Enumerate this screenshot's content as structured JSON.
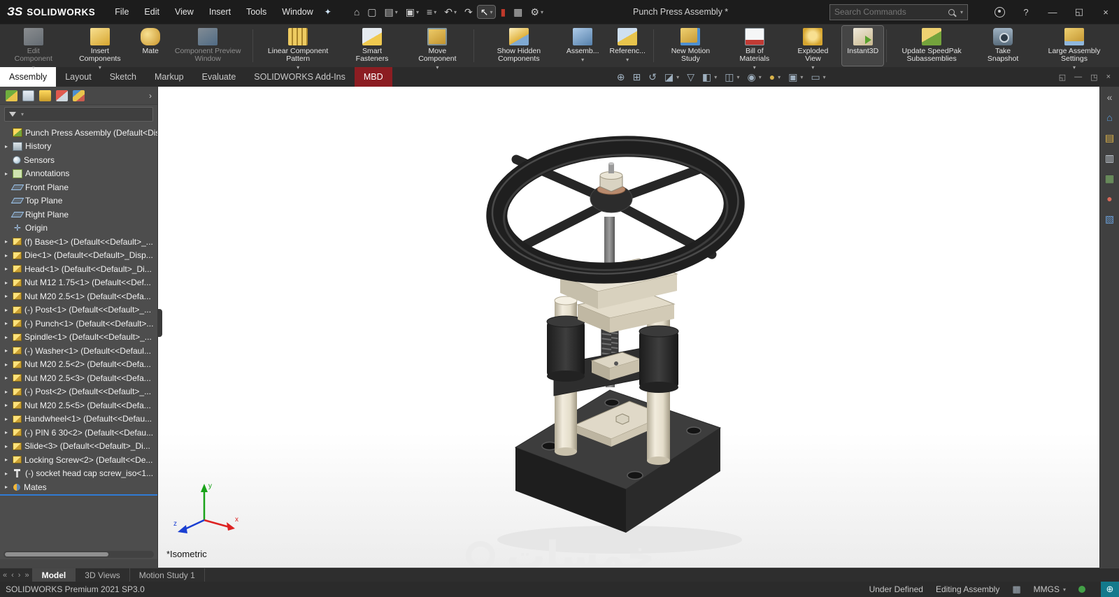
{
  "colors": {
    "selection_accent": "#2f7bd4",
    "mbd_red": "#8c1d22",
    "status_tile_teal": "#137a8c",
    "tab_active_bg": "#ffffff"
  },
  "titlebar": {
    "logo": "ЗS",
    "brand": "SOLIDWORKS",
    "menus": [
      "File",
      "Edit",
      "View",
      "Insert",
      "Tools",
      "Window"
    ],
    "pin_glyph": "✦",
    "tools": [
      {
        "name": "home-icon",
        "glyph": "⌂"
      },
      {
        "name": "new-document-icon",
        "glyph": "▢"
      },
      {
        "name": "open-document-icon",
        "glyph": "▤",
        "caret": true
      },
      {
        "name": "save-icon",
        "glyph": "▣",
        "caret": true
      },
      {
        "name": "print-icon",
        "glyph": "≡",
        "caret": true
      },
      {
        "name": "undo-icon",
        "glyph": "↶",
        "caret": true
      },
      {
        "name": "redo-icon",
        "glyph": "↷"
      },
      {
        "name": "select-arrow-icon",
        "glyph": "↖",
        "active": true,
        "caret": true
      },
      {
        "name": "record-icon",
        "glyph": "▮",
        "red": true
      },
      {
        "name": "spreadsheet-icon",
        "glyph": "▦"
      },
      {
        "name": "options-gear-icon",
        "glyph": "⚙",
        "caret": true
      }
    ],
    "document_title": "Punch Press Assembly *",
    "search_placeholder": "Search Commands",
    "search_caret": "▾",
    "right_icons": [
      {
        "name": "account-icon",
        "glyph": ""
      },
      {
        "name": "help-icon",
        "glyph": "?"
      },
      {
        "name": "minimize-icon",
        "glyph": "—"
      },
      {
        "name": "restore-icon",
        "glyph": "◱"
      },
      {
        "name": "close-icon",
        "glyph": "×"
      }
    ]
  },
  "ribbon": {
    "buttons": [
      {
        "label": "Edit Component",
        "icon": "edit-component-icon",
        "icon_class": "ri-editc",
        "dropdown": true,
        "disabled": true
      },
      {
        "label": "Insert Components",
        "icon": "insert-components-icon",
        "icon_class": "ri-insertc",
        "dropdown": true
      },
      {
        "label": "Mate",
        "icon": "mate-icon",
        "icon_class": "ri-mate"
      },
      {
        "label": "Component Preview Window",
        "icon": "component-preview-icon",
        "icon_class": "ri-prevw",
        "disabled": true
      },
      {
        "label": "Linear Component Pattern",
        "icon": "linear-pattern-icon",
        "icon_class": "ri-linpat",
        "dropdown": true,
        "sep": true
      },
      {
        "label": "Smart Fasteners",
        "icon": "smart-fasteners-icon",
        "icon_class": "ri-smartf"
      },
      {
        "label": "Move Component",
        "icon": "move-component-icon",
        "icon_class": "ri-movec",
        "dropdown": true
      },
      {
        "label": "Show Hidden Components",
        "icon": "show-hidden-icon",
        "icon_class": "ri-showh",
        "sep": true
      },
      {
        "label": "Assemb...",
        "icon": "assembly-features-icon",
        "icon_class": "ri-asmfeat",
        "dropdown": true
      },
      {
        "label": "Referenc...",
        "icon": "reference-geometry-icon",
        "icon_class": "ri-refgeo",
        "dropdown": true
      },
      {
        "label": "New Motion Study",
        "icon": "new-motion-study-icon",
        "icon_class": "ri-motion",
        "sep": true
      },
      {
        "label": "Bill of Materials",
        "icon": "bill-of-materials-icon",
        "icon_class": "ri-bom",
        "dropdown": true
      },
      {
        "label": "Exploded View",
        "icon": "exploded-view-icon",
        "icon_class": "ri-explode",
        "dropdown": true
      },
      {
        "label": "Instant3D",
        "icon": "instant3d-icon",
        "icon_class": "ri-instant3d",
        "active": true
      },
      {
        "label": "Update SpeedPak Subassemblies",
        "icon": "update-speedpak-icon",
        "icon_class": "ri-speedpak",
        "sep": true
      },
      {
        "label": "Take Snapshot",
        "icon": "take-snapshot-icon",
        "icon_class": "ri-snapshot"
      },
      {
        "label": "Large Assembly Settings",
        "icon": "large-assembly-icon",
        "icon_class": "ri-lrgasm",
        "dropdown": true
      }
    ]
  },
  "tabs": [
    {
      "label": "Assembly",
      "active": true
    },
    {
      "label": "Layout"
    },
    {
      "label": "Sketch"
    },
    {
      "label": "Markup"
    },
    {
      "label": "Evaluate"
    },
    {
      "label": "SOLIDWORKS Add-Ins"
    },
    {
      "label": "MBD",
      "style": "mbd"
    }
  ],
  "headsup": [
    {
      "name": "zoom-fit-icon",
      "glyph": "⊕"
    },
    {
      "name": "zoom-area-icon",
      "glyph": "⊞"
    },
    {
      "name": "previous-view-icon",
      "glyph": "↺"
    },
    {
      "name": "section-view-icon",
      "glyph": "◪",
      "caret": true
    },
    {
      "name": "dynamic-annotation-icon",
      "glyph": "▽"
    },
    {
      "name": "view-orientation-icon",
      "glyph": "◧",
      "caret": true
    },
    {
      "name": "display-style-icon",
      "glyph": "◫",
      "caret": true
    },
    {
      "name": "hide-show-icon",
      "glyph": "◉",
      "caret": true
    },
    {
      "name": "edit-appearance-icon",
      "glyph": "●",
      "gold": true,
      "caret": true
    },
    {
      "name": "apply-scene-icon",
      "glyph": "▣",
      "caret": true
    },
    {
      "name": "view-settings-icon",
      "glyph": "▭",
      "caret": true
    }
  ],
  "doc_controls": [
    {
      "name": "doc-undock-icon",
      "glyph": "◱"
    },
    {
      "name": "doc-minimize-icon",
      "glyph": "—"
    },
    {
      "name": "doc-restore-icon",
      "glyph": "◳"
    },
    {
      "name": "doc-close-icon",
      "glyph": "×"
    }
  ],
  "panel": {
    "tabs": [
      {
        "name": "featuremanager-tab-icon",
        "cls": "pt-fm"
      },
      {
        "name": "propertymanager-tab-icon",
        "cls": "pt-pm"
      },
      {
        "name": "configurationmanager-tab-icon",
        "cls": "pt-cm"
      },
      {
        "name": "dimxpertmanager-tab-icon",
        "cls": "pt-dx"
      },
      {
        "name": "displaymanager-tab-icon",
        "cls": "pt-dm"
      }
    ],
    "expand_chevron": "›",
    "tree": [
      {
        "label": "Punch Press Assembly  (Default<Disp...",
        "icon": "assembly-icon",
        "icon_class": "i-asm"
      },
      {
        "label": "History",
        "icon": "history-folder-icon",
        "icon_class": "i-hist",
        "caret": true
      },
      {
        "label": "Sensors",
        "icon": "sensors-icon",
        "icon_class": "i-sens"
      },
      {
        "label": "Annotations",
        "icon": "annotations-icon",
        "icon_class": "i-ann",
        "caret": true
      },
      {
        "label": "Front Plane",
        "icon": "plane-icon",
        "icon_class": "i-plane"
      },
      {
        "label": "Top Plane",
        "icon": "plane-icon",
        "icon_class": "i-plane"
      },
      {
        "label": "Right Plane",
        "icon": "plane-icon",
        "icon_class": "i-plane"
      },
      {
        "label": "Origin",
        "icon": "origin-icon",
        "icon_class": "i-origin",
        "glyph": "✛"
      },
      {
        "label": "(f) Base<1> (Default<<Default>_...",
        "icon": "part-icon",
        "icon_class": "i-part",
        "caret": true
      },
      {
        "label": "Die<1> (Default<<Default>_Disp...",
        "icon": "part-icon",
        "icon_class": "i-part",
        "caret": true
      },
      {
        "label": "Head<1> (Default<<Default>_Di...",
        "icon": "part-icon",
        "icon_class": "i-part",
        "caret": true
      },
      {
        "label": "Nut M12 1.75<1> (Default<<Def...",
        "icon": "part-icon",
        "icon_class": "i-part",
        "caret": true
      },
      {
        "label": "Nut M20 2.5<1> (Default<<Defa...",
        "icon": "part-icon",
        "icon_class": "i-part",
        "caret": true
      },
      {
        "label": "(-) Post<1> (Default<<Default>_...",
        "icon": "part-icon",
        "icon_class": "i-part",
        "caret": true
      },
      {
        "label": "(-) Punch<1> (Default<<Default>...",
        "icon": "part-icon",
        "icon_class": "i-part",
        "caret": true
      },
      {
        "label": "Spindle<1> (Default<<Default>_...",
        "icon": "part-icon",
        "icon_class": "i-part",
        "caret": true
      },
      {
        "label": "(-) Washer<1> (Default<<Defaul...",
        "icon": "part-icon",
        "icon_class": "i-part",
        "caret": true
      },
      {
        "label": "Nut M20 2.5<2> (Default<<Defa...",
        "icon": "part-icon",
        "icon_class": "i-part",
        "caret": true
      },
      {
        "label": "Nut M20 2.5<3> (Default<<Defa...",
        "icon": "part-icon",
        "icon_class": "i-part",
        "caret": true
      },
      {
        "label": "(-) Post<2> (Default<<Default>_...",
        "icon": "part-icon",
        "icon_class": "i-part",
        "caret": true
      },
      {
        "label": "Nut M20 2.5<5> (Default<<Defa...",
        "icon": "part-icon",
        "icon_class": "i-part",
        "caret": true
      },
      {
        "label": "Handwheel<1> (Default<<Defau...",
        "icon": "part-icon",
        "icon_class": "i-part",
        "caret": true
      },
      {
        "label": "(-) PIN 6 30<2> (Default<<Defau...",
        "icon": "part-icon",
        "icon_class": "i-part",
        "caret": true
      },
      {
        "label": "Slide<3> (Default<<Default>_Di...",
        "icon": "part-icon",
        "icon_class": "i-part",
        "caret": true
      },
      {
        "label": "Locking Screw<2> (Default<<De...",
        "icon": "part-icon",
        "icon_class": "i-part",
        "caret": true
      },
      {
        "label": "(-) socket head cap screw_iso<1...",
        "icon": "screw-icon",
        "icon_class": "i-screw",
        "caret": true
      },
      {
        "label": "Mates",
        "icon": "mates-icon",
        "icon_class": "i-mates",
        "caret": true,
        "selected": true
      }
    ]
  },
  "viewport": {
    "view_label": "*Isometric",
    "watermark": "خمسات",
    "triad_labels": {
      "x": "x",
      "y": "y",
      "z": "z"
    }
  },
  "taskpane": [
    {
      "name": "collapse-taskpane-icon",
      "glyph": "«",
      "color": "#b9b9b9"
    },
    {
      "name": "task-pane-home-icon",
      "glyph": "⌂",
      "color": "#5aa0e0"
    },
    {
      "name": "design-library-icon",
      "glyph": "▤",
      "color": "#e0b54a"
    },
    {
      "name": "file-explorer-icon",
      "glyph": "▥",
      "color": "#c9d2da"
    },
    {
      "name": "view-palette-icon",
      "glyph": "▦",
      "color": "#7fb56a"
    },
    {
      "name": "appearances-icon",
      "glyph": "●",
      "color": "#d86a5a"
    },
    {
      "name": "custom-properties-icon",
      "glyph": "▧",
      "color": "#6a9fd8"
    }
  ],
  "bottom": {
    "nav": [
      {
        "name": "first-tab-icon",
        "glyph": "«"
      },
      {
        "name": "prev-tab-icon",
        "glyph": "‹"
      },
      {
        "name": "next-tab-icon",
        "glyph": "›"
      },
      {
        "name": "last-tab-icon",
        "glyph": "»"
      }
    ],
    "tabs": [
      {
        "label": "Model",
        "active": true
      },
      {
        "label": "3D Views"
      },
      {
        "label": "Motion Study 1"
      }
    ]
  },
  "statusbar": {
    "left": "SOLIDWORKS Premium 2021 SP3.0",
    "right": [
      {
        "type": "text",
        "name": "status-under-defined",
        "value": "Under Defined"
      },
      {
        "type": "text",
        "name": "status-editing-assembly",
        "value": "Editing Assembly"
      },
      {
        "type": "icon",
        "name": "status-sheet-icon",
        "glyph": "▦"
      },
      {
        "type": "text",
        "name": "status-units",
        "value": "MMGS",
        "caret": true
      },
      {
        "type": "dot",
        "name": "status-tag-icon"
      },
      {
        "type": "tile",
        "name": "status-help-tile-icon",
        "glyph": "⊕"
      }
    ]
  }
}
